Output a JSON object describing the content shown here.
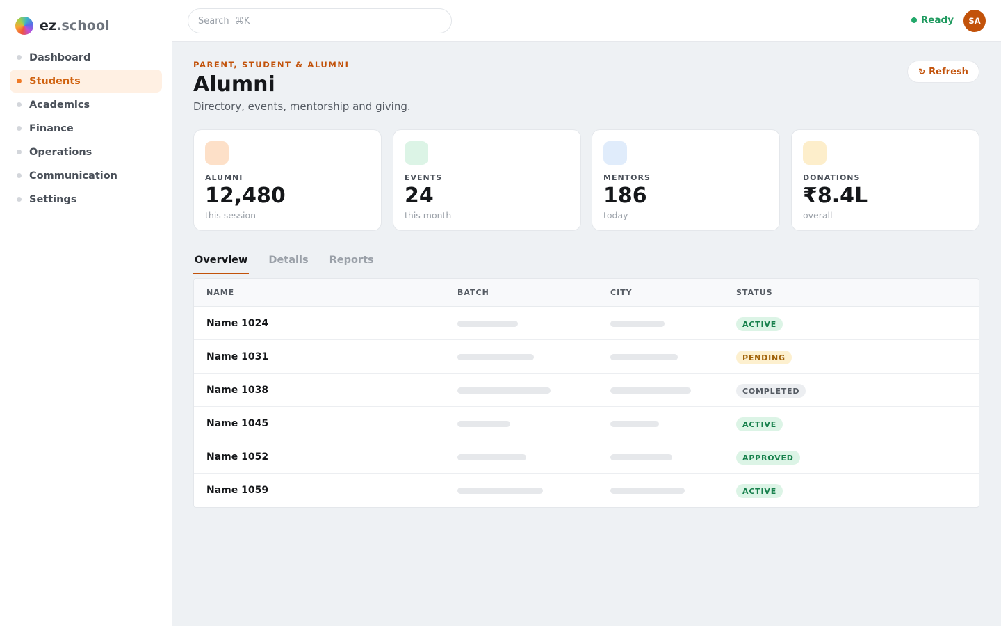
{
  "brand": {
    "name_strong": "ez",
    "name_dim": ".school"
  },
  "nav": [
    {
      "label": "Dashboard",
      "active": false
    },
    {
      "label": "Students",
      "active": true
    },
    {
      "label": "Academics",
      "active": false
    },
    {
      "label": "Finance",
      "active": false
    },
    {
      "label": "Operations",
      "active": false
    },
    {
      "label": "Communication",
      "active": false
    },
    {
      "label": "Settings",
      "active": false
    }
  ],
  "topbar": {
    "search_placeholder": "Search  ⌘K",
    "status_label": "Ready",
    "status_color": "#22a86a",
    "avatar_initials": "SA"
  },
  "header": {
    "kicker": "PARENT, STUDENT & ALUMNI",
    "title": "Alumni",
    "subtitle": "Directory, events, mentorship and giving.",
    "refresh_label": "Refresh",
    "refresh_icon": "↻"
  },
  "stats": [
    {
      "label": "ALUMNI",
      "value": "12,480",
      "sub": "this session",
      "icon_color": "#fde0c8"
    },
    {
      "label": "EVENTS",
      "value": "24",
      "sub": "this month",
      "icon_color": "#dcf4e6"
    },
    {
      "label": "MENTORS",
      "value": "186",
      "sub": "today",
      "icon_color": "#e0ecfb"
    },
    {
      "label": "DONATIONS",
      "value": "₹8.4L",
      "sub": "overall",
      "icon_color": "#fdeecb"
    }
  ],
  "tabs": [
    {
      "label": "Overview",
      "active": true
    },
    {
      "label": "Details",
      "active": false
    },
    {
      "label": "Reports",
      "active": false
    }
  ],
  "table": {
    "columns": [
      "NAME",
      "BATCH",
      "CITY",
      "STATUS"
    ],
    "rows": [
      {
        "name": "Name 1024",
        "status": "ACTIVE",
        "kind": "active"
      },
      {
        "name": "Name 1031",
        "status": "PENDING",
        "kind": "pending"
      },
      {
        "name": "Name 1038",
        "status": "COMPLETED",
        "kind": "completed"
      },
      {
        "name": "Name 1045",
        "status": "ACTIVE",
        "kind": "active"
      },
      {
        "name": "Name 1052",
        "status": "APPROVED",
        "kind": "approved"
      },
      {
        "name": "Name 1059",
        "status": "ACTIVE",
        "kind": "active"
      }
    ]
  }
}
